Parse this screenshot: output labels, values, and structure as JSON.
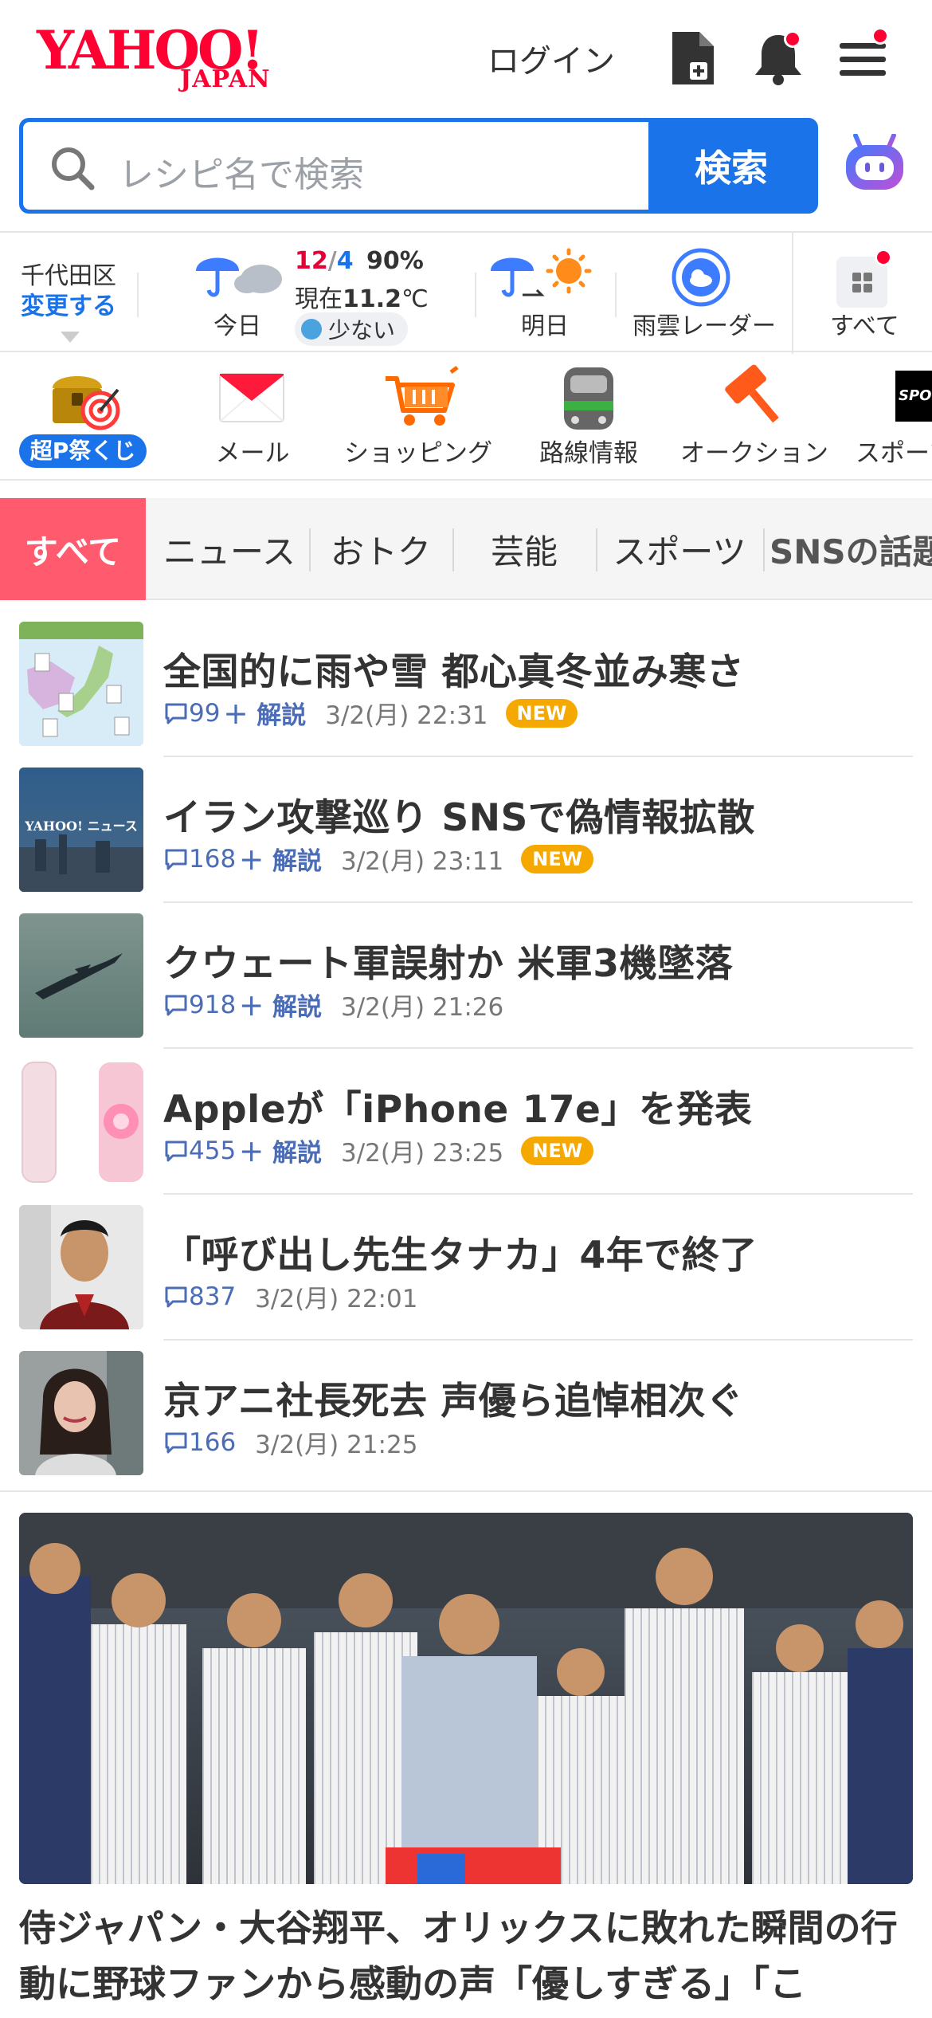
{
  "header": {
    "logo_main": "YAHOO!",
    "logo_sub": "JAPAN",
    "login": "ログイン"
  },
  "search": {
    "placeholder": "レシピ名で検索",
    "button": "検索"
  },
  "weather": {
    "location": "千代田区",
    "change": "変更する",
    "today_label": "今日",
    "today_date_hi": "12",
    "today_date_sep": "/",
    "today_date_lo": "4",
    "precip": "90%",
    "current_prefix": "現在",
    "current_temp": "11.2",
    "current_unit": "℃",
    "pollen": "少ない",
    "tomorrow_label": "明日",
    "radar_label": "雨雲レーダー",
    "all_label": "すべて"
  },
  "services": [
    {
      "label": "超P祭くじ"
    },
    {
      "label": "メール"
    },
    {
      "label": "ショッピング"
    },
    {
      "label": "路線情報"
    },
    {
      "label": "オークション"
    },
    {
      "label": "スポーツ"
    }
  ],
  "tabs": [
    {
      "label": "すべて"
    },
    {
      "label": "ニュース"
    },
    {
      "label": "おトク"
    },
    {
      "label": "芸能"
    },
    {
      "label": "スポーツ"
    },
    {
      "label": "SNSの話題"
    }
  ],
  "news": [
    {
      "title": "全国的に雨や雪 都心真冬並み寒さ",
      "comments": "99",
      "kaisetsu": "＋ 解説",
      "time": "3/2(月) 22:31",
      "new": "NEW"
    },
    {
      "title": "イラン攻撃巡り SNSで偽情報拡散",
      "comments": "168",
      "kaisetsu": "＋ 解説",
      "time": "3/2(月) 23:11",
      "new": "NEW"
    },
    {
      "title": "クウェート軍誤射か 米軍3機墜落",
      "comments": "918",
      "kaisetsu": "＋ 解説",
      "time": "3/2(月) 21:26",
      "new": ""
    },
    {
      "title": "Appleが「iPhone 17e」を発表",
      "comments": "455",
      "kaisetsu": "＋ 解説",
      "time": "3/2(月) 23:25",
      "new": "NEW"
    },
    {
      "title": "「呼び出し先生タナカ」4年で終了",
      "comments": "837",
      "kaisetsu": "",
      "time": "3/2(月) 22:01",
      "new": ""
    },
    {
      "title": "京アニ社長死去 声優ら追悼相次ぐ",
      "comments": "166",
      "kaisetsu": "",
      "time": "3/2(月) 21:25",
      "new": ""
    }
  ],
  "thumb_text": {
    "news2": "YAHOO! ニュース"
  },
  "feature": {
    "title": "侍ジャパン・大谷翔平、オリックスに敗れた瞬間の行動に野球ファンから感動の声「優しすぎる」「こ"
  },
  "colors": {
    "brand_red": "#ff0033",
    "accent_blue": "#1a73e8",
    "tab_active": "#ff5a6e",
    "new_badge": "#f5a800"
  }
}
